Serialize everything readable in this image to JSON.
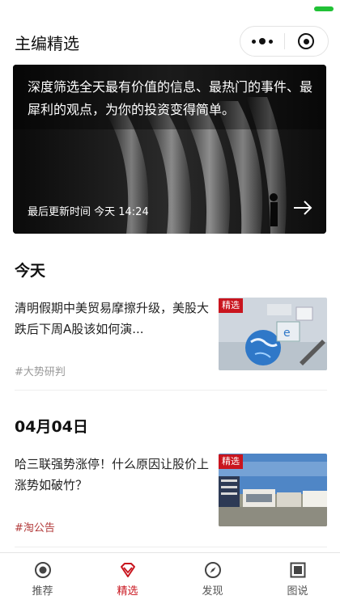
{
  "header": {
    "title": "主编精选"
  },
  "banner": {
    "headline": "深度筛选全天最有价值的信息、最热门的事件、最犀利的观点，为你的投资变得简单。",
    "updated_label": "最后更新时间 今天 14:24"
  },
  "sections": [
    {
      "date": "今天",
      "articles": [
        {
          "title": "清明假期中美贸易摩擦升级，美股大跌后下周A股该如何演...",
          "tag": "#大势研判",
          "badge": "精选"
        }
      ]
    },
    {
      "date": "04月04日",
      "articles": [
        {
          "title": "哈三联强势涨停！什么原因让股价上涨势如破竹？",
          "tag": "#淘公告",
          "badge": "精选"
        }
      ]
    }
  ],
  "tabbar": {
    "items": [
      {
        "label": "推荐",
        "icon": "recommend-icon",
        "active": false
      },
      {
        "label": "精选",
        "icon": "diamond-icon",
        "active": true
      },
      {
        "label": "发现",
        "icon": "compass-icon",
        "active": false
      },
      {
        "label": "图说",
        "icon": "picture-icon",
        "active": false
      }
    ]
  },
  "colors": {
    "accent": "#c9151e",
    "status": "#21c136",
    "tag_gray": "#999999",
    "tag_red": "#b23a3a"
  }
}
